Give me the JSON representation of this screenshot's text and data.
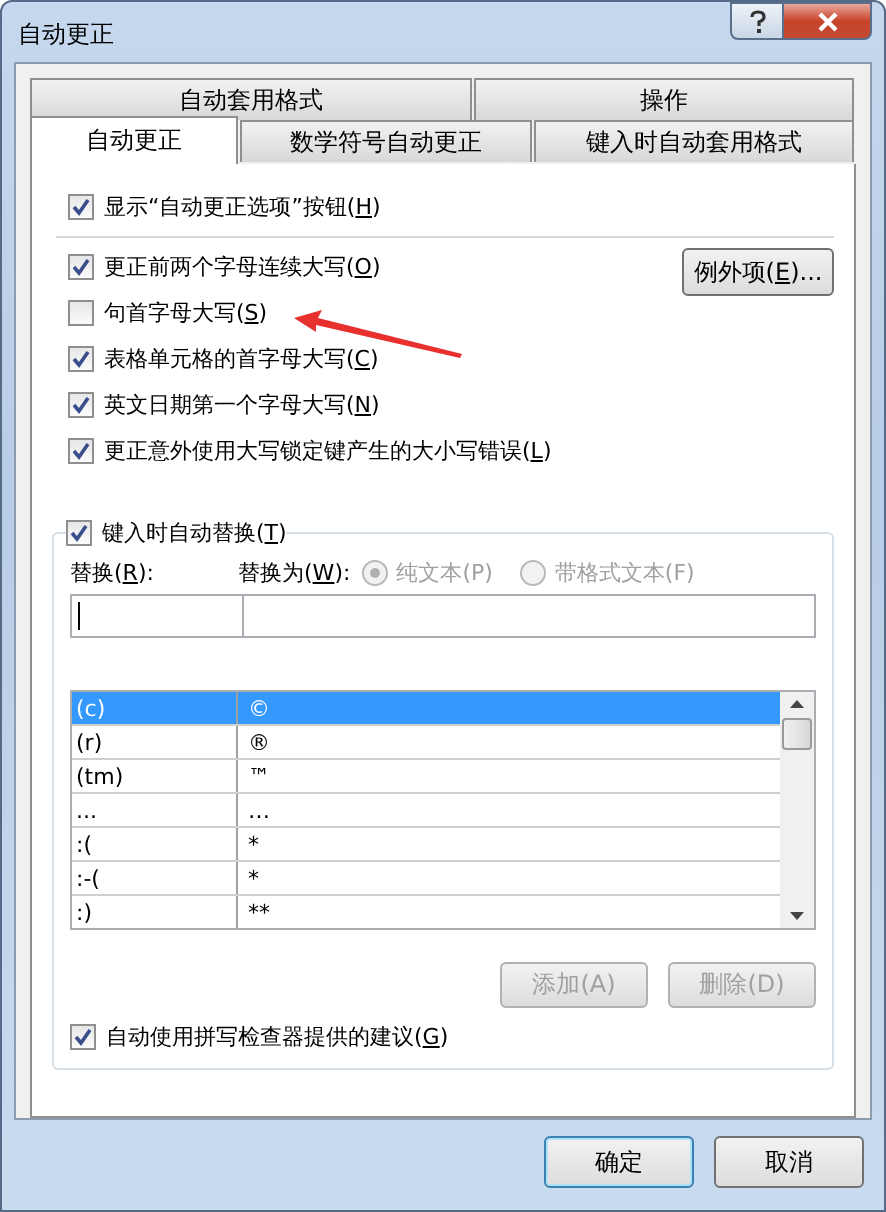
{
  "window": {
    "title": "自动更正"
  },
  "tab_rows": [
    [
      {
        "label": "自动套用格式",
        "selected": false
      },
      {
        "label": "操作",
        "selected": false
      }
    ],
    [
      {
        "label": "自动更正",
        "selected": true
      },
      {
        "label": "数学符号自动更正",
        "selected": false
      },
      {
        "label": "键入时自动套用格式",
        "selected": false
      }
    ]
  ],
  "show_button_option": {
    "label": "显示“自动更正选项”按钮(**H**)",
    "checked": true
  },
  "options": [
    {
      "label": "更正前两个字母连续大写(**O**)",
      "checked": true
    },
    {
      "label": "句首字母大写(**S**)",
      "checked": false
    },
    {
      "label": "表格单元格的首字母大写(**C**)",
      "checked": true
    },
    {
      "label": "英文日期第一个字母大写(**N**)",
      "checked": true
    },
    {
      "label": "更正意外使用大写锁定键产生的大小写错误(**L**)",
      "checked": true
    }
  ],
  "exceptions_button": "例外项(**E**)...",
  "replace_group": {
    "enabled": {
      "label": "键入时自动替换(**T**)",
      "checked": true
    },
    "replace_label": "替换(**R**):",
    "with_label": "替换为(**W**):",
    "format_options": [
      {
        "label": "纯文本(P)",
        "selected": true,
        "disabled": true
      },
      {
        "label": "带格式文本(F)",
        "selected": false,
        "disabled": true
      }
    ],
    "entries": [
      {
        "from": "(c)",
        "to": "©",
        "selected": true
      },
      {
        "from": "(r)",
        "to": "®",
        "selected": false
      },
      {
        "from": "(tm)",
        "to": "™",
        "selected": false
      },
      {
        "from": "...",
        "to": "…",
        "selected": false
      },
      {
        "from": ":(",
        "to": "*",
        "selected": false
      },
      {
        "from": ":-(",
        "to": "*",
        "selected": false
      },
      {
        "from": ":)",
        "to": "**",
        "selected": false
      }
    ],
    "buttons": [
      {
        "label": "添加(A)",
        "disabled": true
      },
      {
        "label": "删除(D)",
        "disabled": true
      }
    ],
    "spelling_option": {
      "label": "自动使用拼写检查器提供的建议(**G**)",
      "checked": true
    }
  },
  "dialog_buttons": [
    {
      "label": "确定",
      "default": true
    },
    {
      "label": "取消",
      "default": false
    }
  ]
}
